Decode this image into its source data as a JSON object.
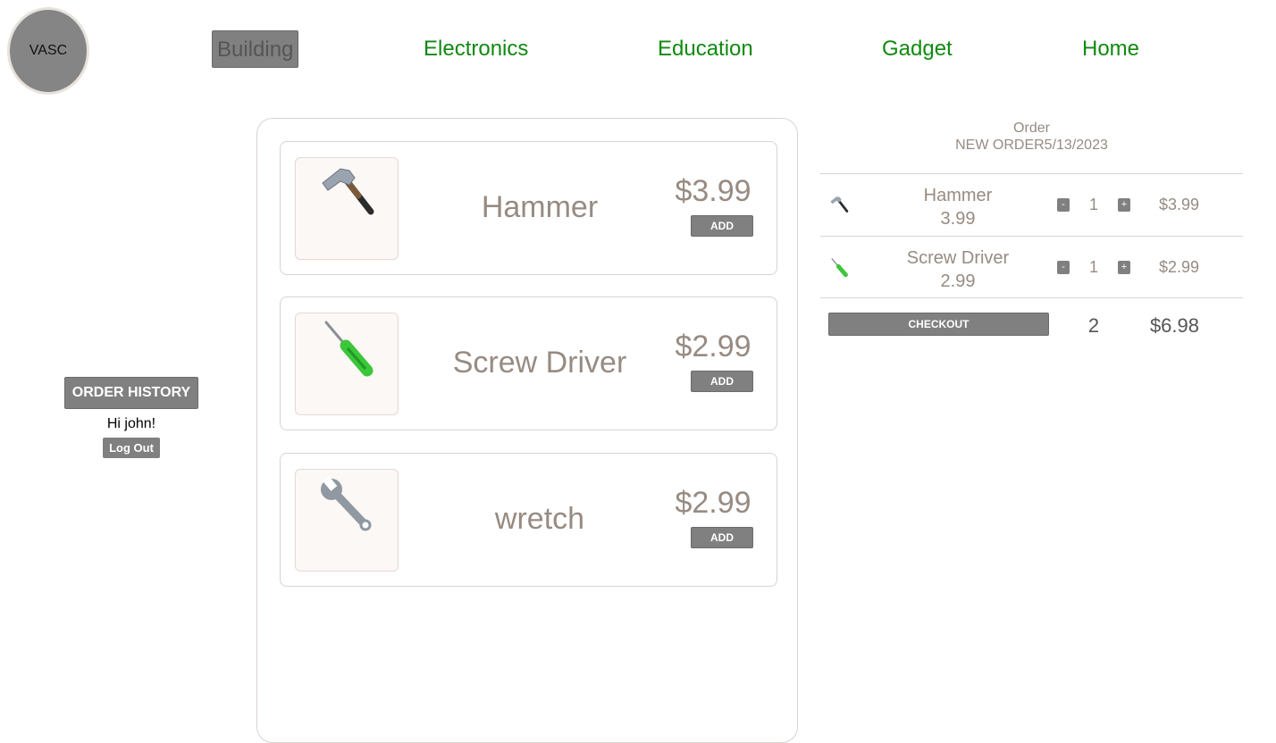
{
  "logo": {
    "text": "VASC"
  },
  "nav": {
    "items": [
      {
        "label": "Building",
        "active": true
      },
      {
        "label": "Electronics",
        "active": false
      },
      {
        "label": "Education",
        "active": false
      },
      {
        "label": "Gadget",
        "active": false
      },
      {
        "label": "Home",
        "active": false
      }
    ]
  },
  "sidebar": {
    "order_history_label": "ORDER HISTORY",
    "greeting": "Hi john!",
    "logout_label": "Log Out"
  },
  "catalog": {
    "add_label": "ADD",
    "products": [
      {
        "name": "Hammer",
        "price": "$3.99",
        "icon": "hammer-icon"
      },
      {
        "name": "Screw Driver",
        "price": "$2.99",
        "icon": "screwdriver-icon"
      },
      {
        "name": "wretch",
        "price": "$2.99",
        "icon": "wrench-icon"
      }
    ]
  },
  "order": {
    "title": "Order",
    "subtitle": "NEW ORDER5/13/2023",
    "items": [
      {
        "name": "Hammer",
        "unit_price": "3.99",
        "qty": "1",
        "total": "$3.99",
        "icon": "hammer-icon"
      },
      {
        "name": "Screw Driver",
        "unit_price": "2.99",
        "qty": "1",
        "total": "$2.99",
        "icon": "screwdriver-icon"
      }
    ],
    "decrement_symbol": "-",
    "increment_symbol": "+",
    "checkout_label": "CHECKOUT",
    "total_qty": "2",
    "total_price": "$6.98"
  },
  "colors": {
    "nav_link": "#108a10",
    "button": "#808080",
    "muted_text": "#978b82"
  }
}
